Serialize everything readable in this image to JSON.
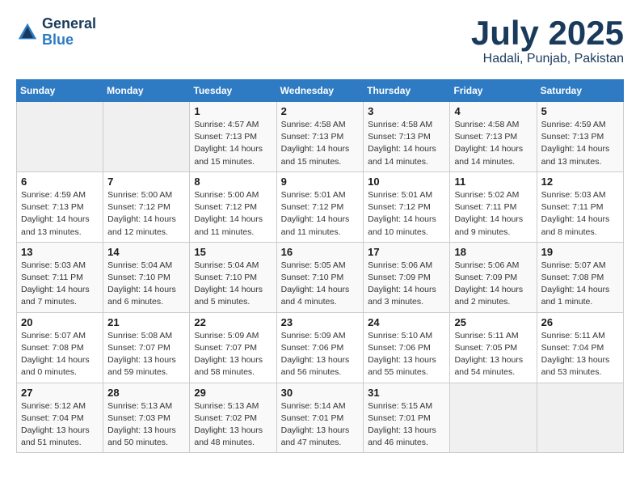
{
  "header": {
    "logo_general": "General",
    "logo_blue": "Blue",
    "month_title": "July 2025",
    "location": "Hadali, Punjab, Pakistan"
  },
  "weekdays": [
    "Sunday",
    "Monday",
    "Tuesday",
    "Wednesday",
    "Thursday",
    "Friday",
    "Saturday"
  ],
  "weeks": [
    [
      {
        "day": "",
        "info": ""
      },
      {
        "day": "",
        "info": ""
      },
      {
        "day": "1",
        "info": "Sunrise: 4:57 AM\nSunset: 7:13 PM\nDaylight: 14 hours and 15 minutes."
      },
      {
        "day": "2",
        "info": "Sunrise: 4:58 AM\nSunset: 7:13 PM\nDaylight: 14 hours and 15 minutes."
      },
      {
        "day": "3",
        "info": "Sunrise: 4:58 AM\nSunset: 7:13 PM\nDaylight: 14 hours and 14 minutes."
      },
      {
        "day": "4",
        "info": "Sunrise: 4:58 AM\nSunset: 7:13 PM\nDaylight: 14 hours and 14 minutes."
      },
      {
        "day": "5",
        "info": "Sunrise: 4:59 AM\nSunset: 7:13 PM\nDaylight: 14 hours and 13 minutes."
      }
    ],
    [
      {
        "day": "6",
        "info": "Sunrise: 4:59 AM\nSunset: 7:13 PM\nDaylight: 14 hours and 13 minutes."
      },
      {
        "day": "7",
        "info": "Sunrise: 5:00 AM\nSunset: 7:12 PM\nDaylight: 14 hours and 12 minutes."
      },
      {
        "day": "8",
        "info": "Sunrise: 5:00 AM\nSunset: 7:12 PM\nDaylight: 14 hours and 11 minutes."
      },
      {
        "day": "9",
        "info": "Sunrise: 5:01 AM\nSunset: 7:12 PM\nDaylight: 14 hours and 11 minutes."
      },
      {
        "day": "10",
        "info": "Sunrise: 5:01 AM\nSunset: 7:12 PM\nDaylight: 14 hours and 10 minutes."
      },
      {
        "day": "11",
        "info": "Sunrise: 5:02 AM\nSunset: 7:11 PM\nDaylight: 14 hours and 9 minutes."
      },
      {
        "day": "12",
        "info": "Sunrise: 5:03 AM\nSunset: 7:11 PM\nDaylight: 14 hours and 8 minutes."
      }
    ],
    [
      {
        "day": "13",
        "info": "Sunrise: 5:03 AM\nSunset: 7:11 PM\nDaylight: 14 hours and 7 minutes."
      },
      {
        "day": "14",
        "info": "Sunrise: 5:04 AM\nSunset: 7:10 PM\nDaylight: 14 hours and 6 minutes."
      },
      {
        "day": "15",
        "info": "Sunrise: 5:04 AM\nSunset: 7:10 PM\nDaylight: 14 hours and 5 minutes."
      },
      {
        "day": "16",
        "info": "Sunrise: 5:05 AM\nSunset: 7:10 PM\nDaylight: 14 hours and 4 minutes."
      },
      {
        "day": "17",
        "info": "Sunrise: 5:06 AM\nSunset: 7:09 PM\nDaylight: 14 hours and 3 minutes."
      },
      {
        "day": "18",
        "info": "Sunrise: 5:06 AM\nSunset: 7:09 PM\nDaylight: 14 hours and 2 minutes."
      },
      {
        "day": "19",
        "info": "Sunrise: 5:07 AM\nSunset: 7:08 PM\nDaylight: 14 hours and 1 minute."
      }
    ],
    [
      {
        "day": "20",
        "info": "Sunrise: 5:07 AM\nSunset: 7:08 PM\nDaylight: 14 hours and 0 minutes."
      },
      {
        "day": "21",
        "info": "Sunrise: 5:08 AM\nSunset: 7:07 PM\nDaylight: 13 hours and 59 minutes."
      },
      {
        "day": "22",
        "info": "Sunrise: 5:09 AM\nSunset: 7:07 PM\nDaylight: 13 hours and 58 minutes."
      },
      {
        "day": "23",
        "info": "Sunrise: 5:09 AM\nSunset: 7:06 PM\nDaylight: 13 hours and 56 minutes."
      },
      {
        "day": "24",
        "info": "Sunrise: 5:10 AM\nSunset: 7:06 PM\nDaylight: 13 hours and 55 minutes."
      },
      {
        "day": "25",
        "info": "Sunrise: 5:11 AM\nSunset: 7:05 PM\nDaylight: 13 hours and 54 minutes."
      },
      {
        "day": "26",
        "info": "Sunrise: 5:11 AM\nSunset: 7:04 PM\nDaylight: 13 hours and 53 minutes."
      }
    ],
    [
      {
        "day": "27",
        "info": "Sunrise: 5:12 AM\nSunset: 7:04 PM\nDaylight: 13 hours and 51 minutes."
      },
      {
        "day": "28",
        "info": "Sunrise: 5:13 AM\nSunset: 7:03 PM\nDaylight: 13 hours and 50 minutes."
      },
      {
        "day": "29",
        "info": "Sunrise: 5:13 AM\nSunset: 7:02 PM\nDaylight: 13 hours and 48 minutes."
      },
      {
        "day": "30",
        "info": "Sunrise: 5:14 AM\nSunset: 7:01 PM\nDaylight: 13 hours and 47 minutes."
      },
      {
        "day": "31",
        "info": "Sunrise: 5:15 AM\nSunset: 7:01 PM\nDaylight: 13 hours and 46 minutes."
      },
      {
        "day": "",
        "info": ""
      },
      {
        "day": "",
        "info": ""
      }
    ]
  ]
}
